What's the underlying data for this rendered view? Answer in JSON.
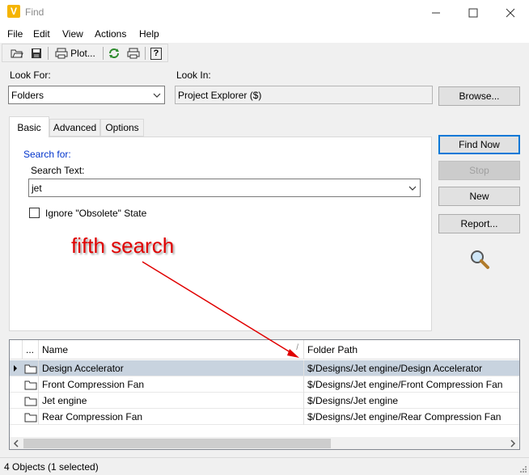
{
  "window": {
    "title": "Find",
    "app_icon_letter": "V"
  },
  "menu": [
    "File",
    "Edit",
    "View",
    "Actions",
    "Help"
  ],
  "toolbar": {
    "plot_label": "Plot...",
    "help_label": "?"
  },
  "look_for": {
    "label": "Look For:",
    "value": "Folders"
  },
  "look_in": {
    "label": "Look In:",
    "value": "Project Explorer ($)",
    "browse": "Browse..."
  },
  "tabs": [
    "Basic",
    "Advanced",
    "Options"
  ],
  "basic": {
    "section": "Search for:",
    "search_text_label": "Search Text:",
    "search_text_value": "jet",
    "ignore_obsolete_label": "Ignore \"Obsolete\" State"
  },
  "buttons": {
    "find_now": "Find Now",
    "stop": "Stop",
    "new": "New",
    "report": "Report..."
  },
  "results": {
    "columns": {
      "more": "...",
      "name": "Name",
      "sort_indicator": "/",
      "folder_path": "Folder Path"
    },
    "rows": [
      {
        "name": "Design Accelerator",
        "path": "$/Designs/Jet engine/Design Accelerator"
      },
      {
        "name": "Front Compression Fan",
        "path": "$/Designs/Jet engine/Front Compression Fan"
      },
      {
        "name": "Jet engine",
        "path": "$/Designs/Jet engine"
      },
      {
        "name": "Rear Compression Fan",
        "path": "$/Designs/Jet engine/Rear Compression Fan"
      }
    ]
  },
  "status": "4 Objects (1 selected)",
  "annotation": {
    "text": "fifth search",
    "color": "#e00000"
  },
  "colors": {
    "accent": "#0078d7",
    "selected_row": "#c8d3df",
    "link_blue": "#0033cc"
  }
}
